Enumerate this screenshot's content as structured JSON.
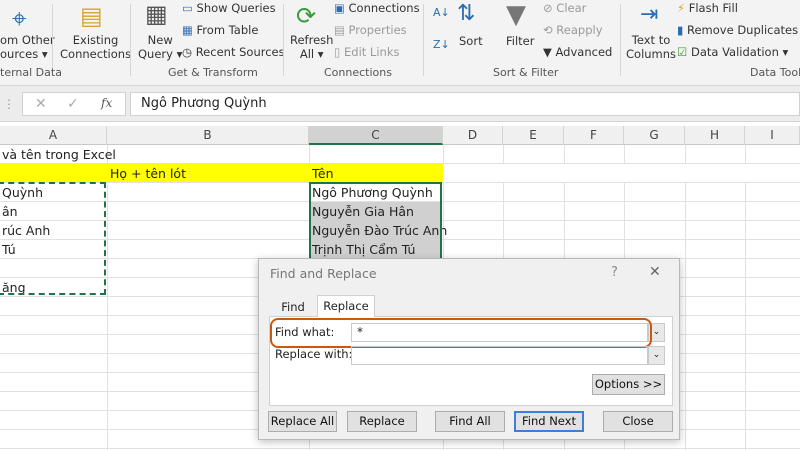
{
  "ribbon": {
    "from_other_sources": [
      "om Other",
      "ources ▾"
    ],
    "existing_connections": [
      "Existing",
      "Connections"
    ],
    "new_query": [
      "New",
      "Query ▾"
    ],
    "show_queries": "Show Queries",
    "from_table": "From Table",
    "recent_sources": "Recent Sources",
    "refresh_all": [
      "Refresh",
      "All ▾"
    ],
    "connections": "Connections",
    "properties": "Properties",
    "edit_links": "Edit Links",
    "sort": "Sort",
    "filter": "Filter",
    "clear": "Clear",
    "reapply": "Reapply",
    "advanced": "Advanced",
    "text_to_columns": [
      "Text to",
      "Columns"
    ],
    "flash_fill": "Flash Fill",
    "remove_duplicates": "Remove Duplicates",
    "data_validation": "Data Validation",
    "groups": {
      "external": "ternal Data",
      "get_transform": "Get & Transform",
      "connections": "Connections",
      "sort_filter": "Sort & Filter",
      "data_tools": "Data Tools"
    }
  },
  "formula_bar": {
    "fx": "fx",
    "value": "Ngô Phương Quỳnh"
  },
  "columns": [
    "A",
    "B",
    "C",
    "D",
    "E",
    "F",
    "G",
    "H",
    "I"
  ],
  "cells": {
    "a1": "và tên trong Excel",
    "b2": "Họ + tên lót",
    "c2": "Tên",
    "a3": "Quỳnh",
    "a4": "ân",
    "a5": "rúc Anh",
    "a6": " Tú",
    "a8": "ăng",
    "c3": "Ngô Phương Quỳnh",
    "c4": "Nguyễn Gia Hân",
    "c5": "Nguyễn Đào Trúc Anh",
    "c6": "Trịnh Thị Cẩm Tú"
  },
  "colors": {
    "yellow": "#ffff00",
    "selection_green": "#217346",
    "highlight": "#c55a11"
  },
  "dialog": {
    "title": "Find and Replace",
    "help": "?",
    "close_x": "✕",
    "tabs": [
      "Find",
      "Replace"
    ],
    "find_what_label": "Find what:",
    "find_what_value": "*",
    "replace_with_label": "Replace with:",
    "replace_with_value": "",
    "options": "Options >>",
    "buttons": [
      "Replace All",
      "Replace",
      "Find All",
      "Find Next",
      "Close"
    ]
  }
}
